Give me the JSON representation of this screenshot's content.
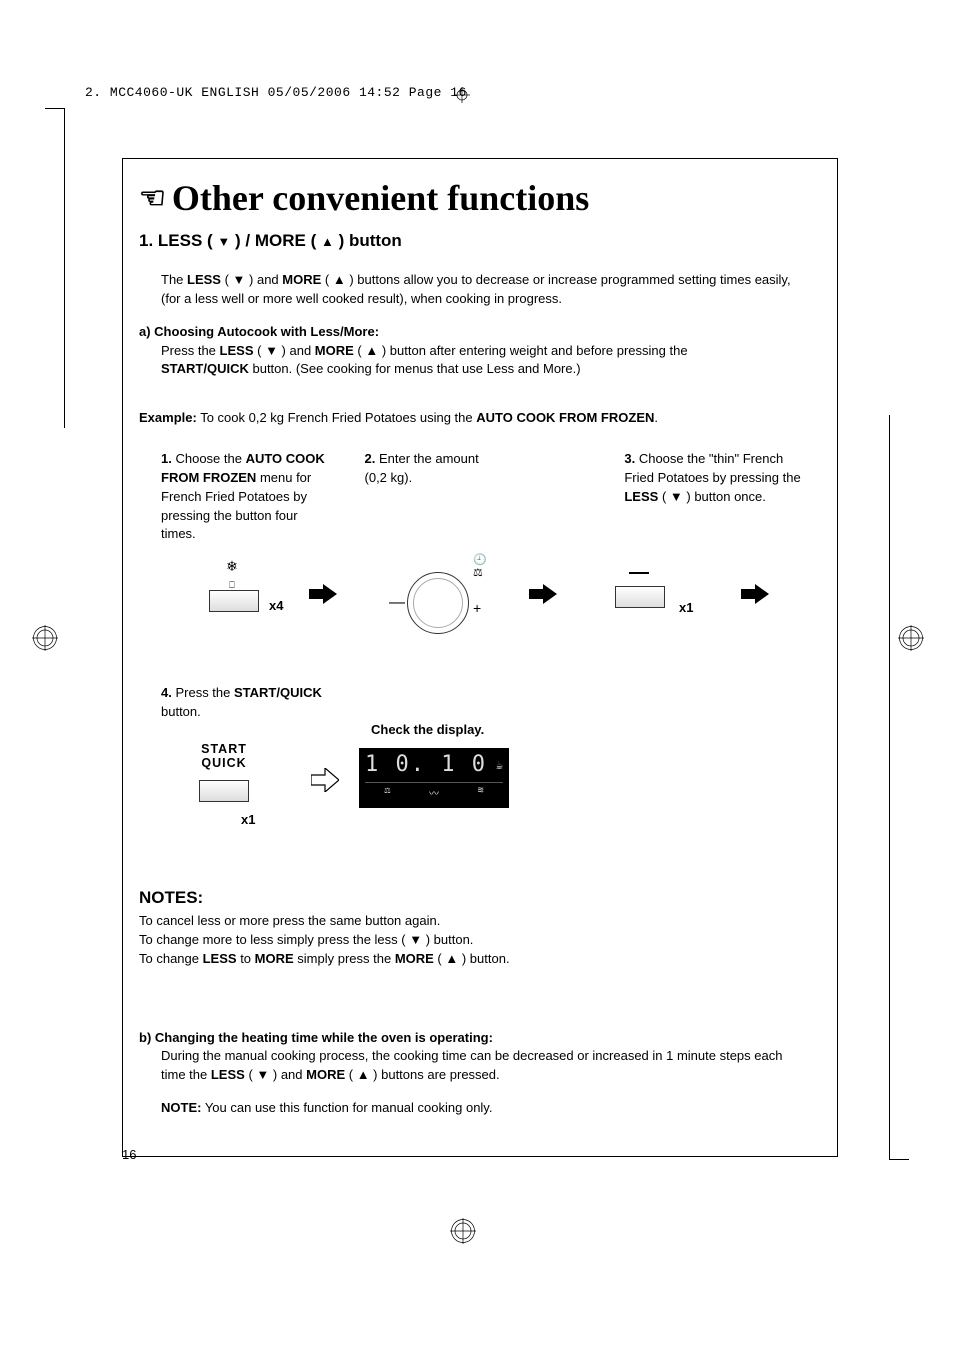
{
  "header": "2. MCC4060-UK ENGLISH  05/05/2006  14:52  Page 16",
  "title": "Other convenient functions",
  "subhead_pre": "1. LESS ( ",
  "subhead_mid": " ) / MORE ( ",
  "subhead_post": " ) button",
  "intro_pre": "The ",
  "intro_less": "LESS",
  "intro_m1": " ( ",
  "intro_m2": " ) and ",
  "intro_more": "MORE",
  "intro_m3": " ( ",
  "intro_m4": " ) buttons allow you to  decrease or increase programmed setting times easily, (for a less well or more well cooked result), when cooking in progress.",
  "a_heading": "a)  Choosing Autocook with Less/More:",
  "a_l1_pre": "Press the ",
  "a_l1_mid1": " ( ",
  "a_l1_mid2": " ) and ",
  "a_l1_mid3": " ( ",
  "a_l1_mid4": " ) button after entering weight and before pressing the ",
  "a_l2_sq": "START/QUICK",
  "a_l2_rest": " button. (See cooking for menus that use Less and More.)",
  "example_b": "Example:",
  "example_t": " To cook 0,2 kg French Fried Potatoes using the ",
  "example_ac": "AUTO COOK FROM FROZEN",
  "step1_n": "1.",
  "step1_pre": "Choose the ",
  "step1_b": "AUTO COOK FROM FROZEN",
  "step1_post": " menu for French Fried Potatoes by pressing the button four times.",
  "step2_n": "2.",
  "step2_t": "Enter the amount (0,2 kg).",
  "step3_n": "3.",
  "step3_pre": "Choose the \"thin\" French Fried Potatoes by pressing the ",
  "step3_b": "LESS",
  "step3_mid": " ( ",
  "step3_post": " ) button once.",
  "x4": "x4",
  "x1": "x1",
  "step4_n": "4.",
  "step4_pre": "Press the ",
  "step4_b": "START/QUICK",
  "step4_post": " button.",
  "check": "Check the display.",
  "sq_label1": "START",
  "sq_label2": "QUICK",
  "display_digits": "1 0. 1 0",
  "notes_h": "NOTES:",
  "notes_l1": "To cancel less or more  press the same button again.",
  "notes_l2_pre": "To change more to less simply press the less ( ",
  "notes_l2_post": " ) button.",
  "notes_l3_pre": "To change ",
  "notes_l3_less": "LESS",
  "notes_l3_mid1": " to ",
  "notes_l3_more": "MORE",
  "notes_l3_mid2": " simply press the ",
  "notes_l3_more2": "MORE",
  "notes_l3_mid3": " ( ",
  "notes_l3_post": " ) button.",
  "b_heading": "b)  Changing the heating time while the oven is operating:",
  "b_l1_pre": "During the manual cooking process, the cooking time can be decreased or increased in 1 minute steps each time the ",
  "b_l1_mid1": " ( ",
  "b_l1_mid2": " ) and ",
  "b_l1_mid3": " ( ",
  "b_l1_post": " ) buttons are pressed.",
  "b_note_b": "NOTE:",
  "b_note_t": " You can use this function for manual cooking only.",
  "page_num": "16"
}
